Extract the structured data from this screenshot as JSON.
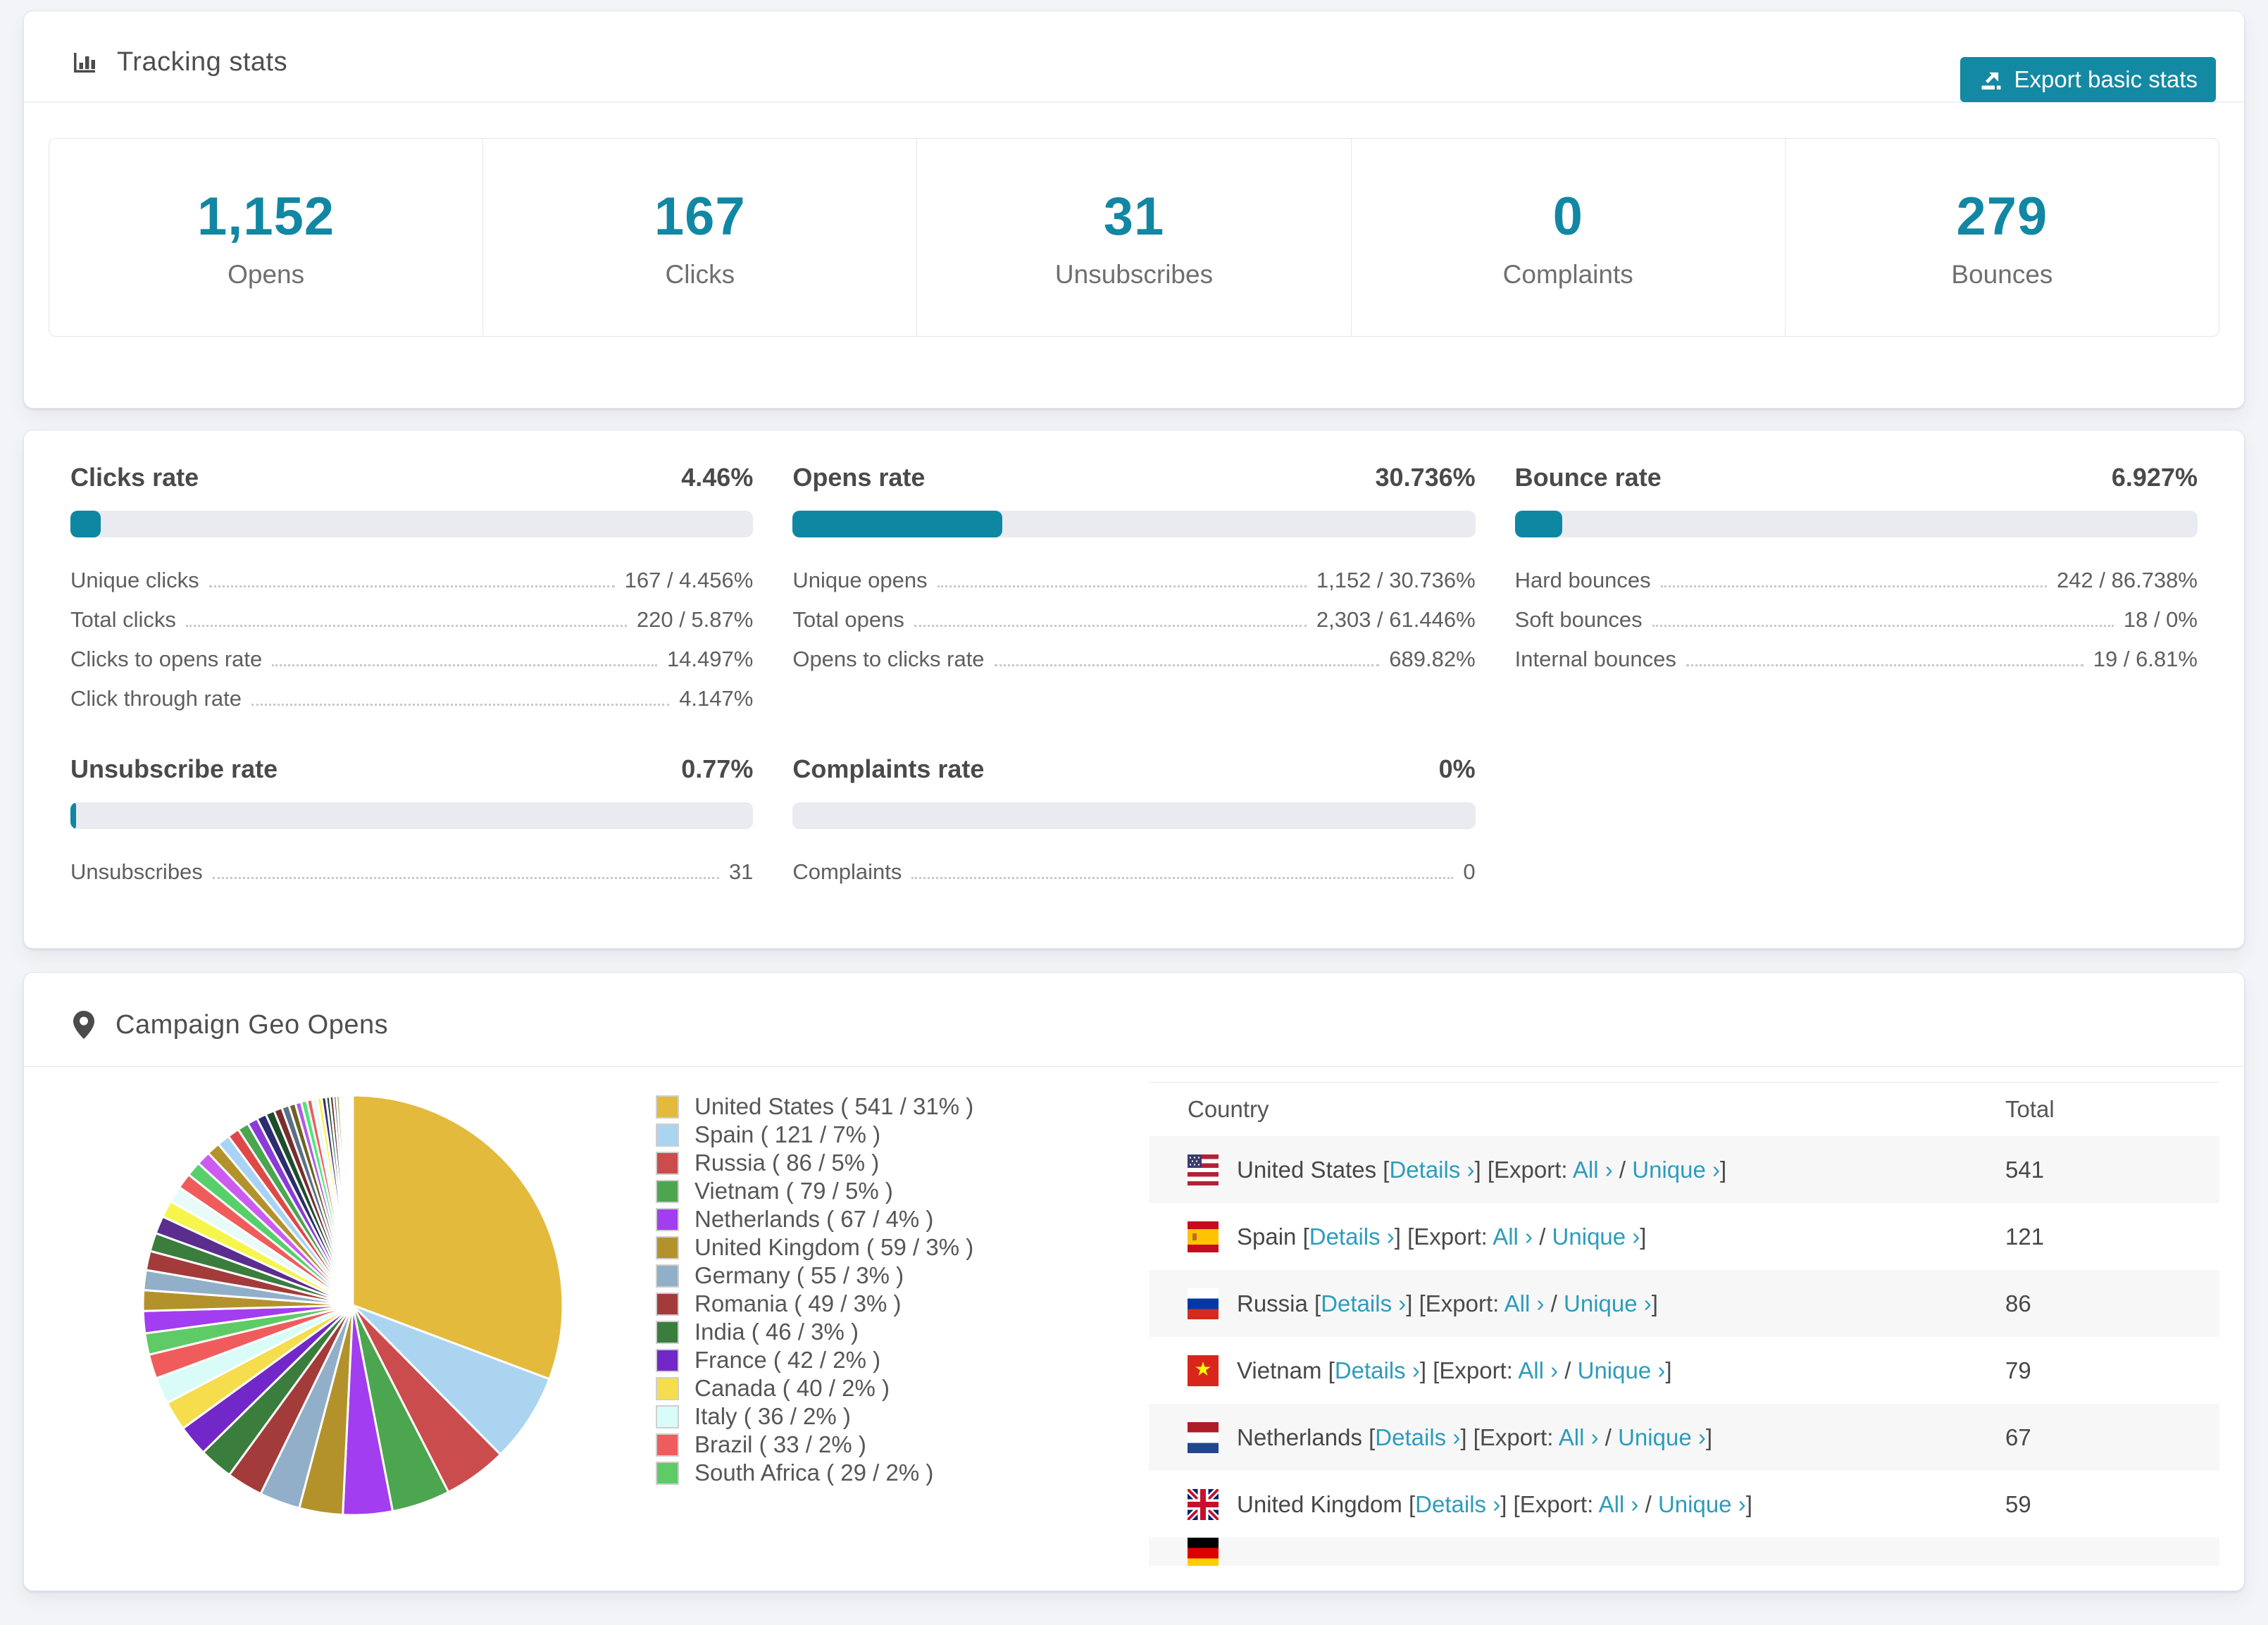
{
  "page": {
    "background": "#f3f4f7",
    "accent": "#1187a4"
  },
  "tracking": {
    "title": "Tracking stats",
    "export_label": "Export basic stats",
    "stats": [
      {
        "value": "1,152",
        "label": "Opens"
      },
      {
        "value": "167",
        "label": "Clicks"
      },
      {
        "value": "31",
        "label": "Unsubscribes"
      },
      {
        "value": "0",
        "label": "Complaints"
      },
      {
        "value": "279",
        "label": "Bounces"
      }
    ]
  },
  "rates": [
    {
      "title": "Clicks rate",
      "value": "4.46%",
      "percent": 4.46,
      "rows": [
        {
          "label": "Unique clicks",
          "value": "167 / 4.456%"
        },
        {
          "label": "Total clicks",
          "value": "220 / 5.87%"
        },
        {
          "label": "Clicks to opens rate",
          "value": "14.497%"
        },
        {
          "label": "Click through rate",
          "value": "4.147%"
        }
      ]
    },
    {
      "title": "Opens rate",
      "value": "30.736%",
      "percent": 30.736,
      "rows": [
        {
          "label": "Unique opens",
          "value": "1,152 / 30.736%"
        },
        {
          "label": "Total opens",
          "value": "2,303 / 61.446%"
        },
        {
          "label": "Opens to clicks rate",
          "value": "689.82%"
        }
      ]
    },
    {
      "title": "Bounce rate",
      "value": "6.927%",
      "percent": 6.927,
      "rows": [
        {
          "label": "Hard bounces",
          "value": "242 / 86.738%"
        },
        {
          "label": "Soft bounces",
          "value": "18 / 0%"
        },
        {
          "label": "Internal bounces",
          "value": "19 / 6.81%"
        }
      ]
    },
    {
      "title": "Unsubscribe rate",
      "value": "0.77%",
      "percent": 0.77,
      "rows": [
        {
          "label": "Unsubscribes",
          "value": "31"
        }
      ]
    },
    {
      "title": "Complaints rate",
      "value": "0%",
      "percent": 0,
      "rows": [
        {
          "label": "Complaints",
          "value": "0"
        }
      ]
    }
  ],
  "geo": {
    "title": "Campaign Geo Opens",
    "chart_data": {
      "type": "pie",
      "title": "Campaign Geo Opens",
      "legend_position": "right",
      "start_angle_deg": -90,
      "direction": "clockwise",
      "series": [
        {
          "name": "United States",
          "value": 541,
          "pct_label": "31%",
          "color": "#e3ba3c",
          "flag": "us"
        },
        {
          "name": "Spain",
          "value": 121,
          "pct_label": "7%",
          "color": "#abd4f1",
          "flag": "es"
        },
        {
          "name": "Russia",
          "value": 86,
          "pct_label": "5%",
          "color": "#cb4c4c",
          "flag": "ru"
        },
        {
          "name": "Vietnam",
          "value": 79,
          "pct_label": "5%",
          "color": "#4ba64f",
          "flag": "vn"
        },
        {
          "name": "Netherlands",
          "value": 67,
          "pct_label": "4%",
          "color": "#a23df0",
          "flag": "nl"
        },
        {
          "name": "United Kingdom",
          "value": 59,
          "pct_label": "3%",
          "color": "#b3922b",
          "flag": "gb"
        },
        {
          "name": "Germany",
          "value": 55,
          "pct_label": "3%",
          "color": "#92afc9",
          "flag": "de"
        },
        {
          "name": "Romania",
          "value": 49,
          "pct_label": "3%",
          "color": "#a33b3b",
          "flag": "ro"
        },
        {
          "name": "India",
          "value": 46,
          "pct_label": "3%",
          "color": "#3a7d3d",
          "flag": "in"
        },
        {
          "name": "France",
          "value": 42,
          "pct_label": "2%",
          "color": "#7227c8",
          "flag": "fr"
        },
        {
          "name": "Canada",
          "value": 40,
          "pct_label": "2%",
          "color": "#f5dd4d",
          "flag": "ca"
        },
        {
          "name": "Italy",
          "value": 36,
          "pct_label": "2%",
          "color": "#d9fcf8",
          "flag": "it"
        },
        {
          "name": "Brazil",
          "value": 33,
          "pct_label": "2%",
          "color": "#f05c5c",
          "flag": "br"
        },
        {
          "name": "South Africa",
          "value": 29,
          "pct_label": "2%",
          "color": "#5ecb66",
          "flag": "za"
        }
      ],
      "other_slices_estimated": {
        "values": [
          30,
          28,
          27,
          26,
          25,
          24,
          23,
          22,
          21,
          20,
          19,
          18,
          17,
          16,
          15,
          14,
          13,
          12,
          11,
          10,
          9,
          8,
          8,
          7,
          7,
          6,
          6,
          5,
          5,
          4,
          4,
          3,
          3,
          2,
          2,
          2,
          1,
          1,
          1,
          1,
          1,
          1
        ],
        "colors": [
          "#a23df0",
          "#b3922b",
          "#92afc9",
          "#a33b3b",
          "#3a7d3d",
          "#5b2d8e",
          "#f5f54e",
          "#e8fbf9",
          "#f05c5c",
          "#57d06b",
          "#cc5cf0",
          "#b3922b",
          "#a9d3f5",
          "#e04848",
          "#4ba64f",
          "#8a3bd8",
          "#2b2d6e",
          "#1d4d2b",
          "#7a2d2d",
          "#5a7086",
          "#6e6420",
          "#b05ce8",
          "#4be87a",
          "#f05c5c",
          "#eafafa",
          "#f5f54e",
          "#3a2d7e",
          "#14532b",
          "#6e2d2d",
          "#44606e",
          "#b3922b",
          "#d65cf0",
          "#57d06b",
          "#a9d3f5",
          "#e04848",
          "#4ba64f",
          "#8a3bd8",
          "#cc9a2e",
          "#a9d3f5",
          "#e04848",
          "#57d06b",
          "#b05ce8"
        ]
      }
    },
    "legend_format": "{name} ( {value} / {pct} )",
    "table": {
      "columns": [
        "Country",
        "Total"
      ],
      "links": {
        "details": "Details ›",
        "export_prefix": "[Export:",
        "all": "All ›",
        "slash": "/",
        "unique": "Unique ›"
      },
      "rows": [
        {
          "country": "United States",
          "flag": "us",
          "total": "541"
        },
        {
          "country": "Spain",
          "flag": "es",
          "total": "121"
        },
        {
          "country": "Russia",
          "flag": "ru",
          "total": "86"
        },
        {
          "country": "Vietnam",
          "flag": "vn",
          "total": "79"
        },
        {
          "country": "Netherlands",
          "flag": "nl",
          "total": "67"
        },
        {
          "country": "United Kingdom",
          "flag": "gb",
          "total": "59"
        },
        {
          "country": "Germany",
          "flag": "de",
          "total": "",
          "partial": true
        }
      ]
    }
  }
}
